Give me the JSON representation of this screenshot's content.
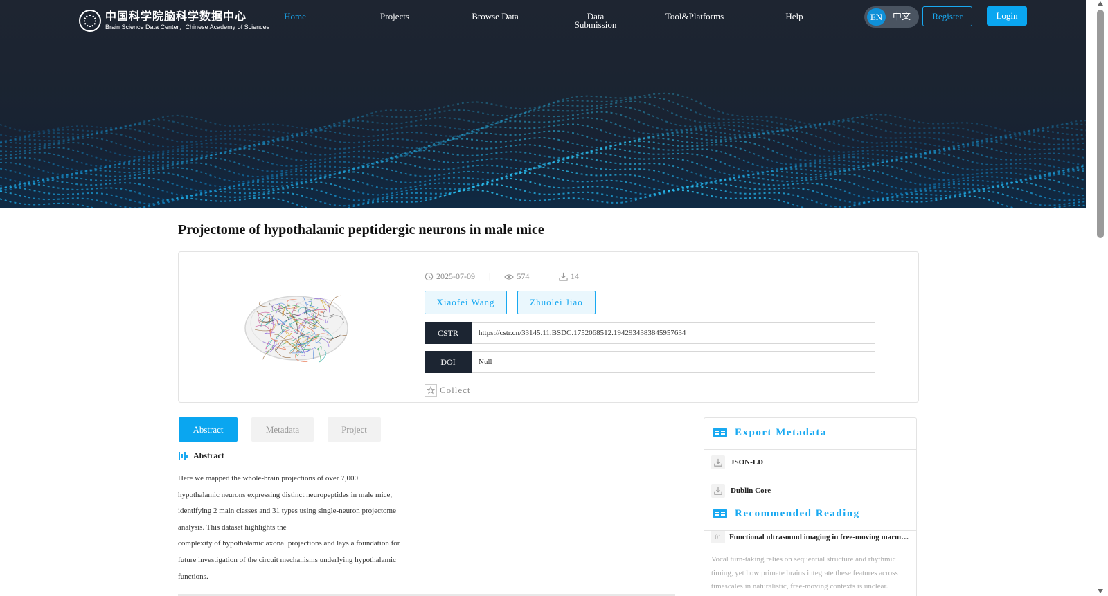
{
  "header": {
    "logo_cn": "中国科学院脑科学数据中心",
    "logo_en": "Brain Science Data Center，Chinese Academy of Sciences",
    "nav": [
      {
        "label": "Home",
        "active": true
      },
      {
        "label": "Projects",
        "active": false
      },
      {
        "label": "Browse Data",
        "active": false
      },
      {
        "label": "Data Submission",
        "active": false
      },
      {
        "label": "Tool&Platforms",
        "active": false
      },
      {
        "label": "Help",
        "active": false
      }
    ],
    "lang_en": "EN",
    "lang_cn": "中文",
    "register_label": "Register",
    "login_label": "Login"
  },
  "dataset": {
    "title": "Projectome of hypothalamic peptidergic neurons in male mice",
    "date": "2025-07-09",
    "views": "574",
    "downloads": "14",
    "authors": [
      "Xiaofei Wang",
      "Zhuolei Jiao"
    ],
    "cstr_label": "CSTR",
    "cstr_value": "https://cstr.cn/33145.11.BSDC.1752068512.1942934383845957634",
    "doi_label": "DOI",
    "doi_value": "Null",
    "collect_label": "Collect"
  },
  "tabs": [
    {
      "label": "Abstract",
      "active": true
    },
    {
      "label": "Metadata",
      "active": false
    },
    {
      "label": "Project",
      "active": false
    }
  ],
  "abstract": {
    "heading": "Abstract",
    "lines": [
      "Here we mapped the whole-brain projections of over 7,000",
      "hypothalamic neurons expressing distinct neuropeptides in male mice,",
      "identifying 2 main classes and 31 types using single-neuron projectome",
      "analysis. This dataset highlights the",
      "complexity of hypothalamic axonal projections and lays a foundation for",
      "future investigation of the circuit mechanisms underlying hypothalamic",
      "functions."
    ]
  },
  "sidebar": {
    "export_title": "Export Metadata",
    "exports": [
      "JSON-LD",
      "Dublin Core"
    ],
    "recommended_title": "Recommended Reading",
    "recommended": [
      {
        "num": "01",
        "title": "Functional ultrasound imaging in free-moving marmosets",
        "desc_lines": [
          "Vocal turn-taking relies on sequential structure and rhythmic",
          "timing, yet how primate brains integrate these features across",
          "timescales in naturalistic, free-moving contexts is unclear."
        ]
      }
    ]
  },
  "colors": {
    "accent": "#0aa6f0",
    "header_bg": "#1e2531",
    "label_bg": "#1c2532"
  }
}
